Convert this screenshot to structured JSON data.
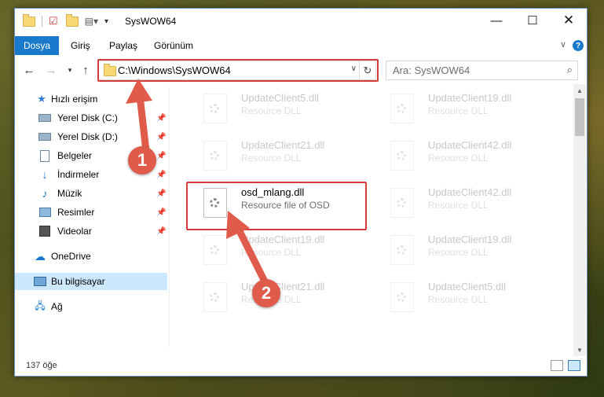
{
  "window": {
    "title": "SysWOW64"
  },
  "ribbon": {
    "tabs": [
      "Dosya",
      "Giriş",
      "Paylaş",
      "Görünüm"
    ],
    "help": "?"
  },
  "navbar": {
    "address": "C:\\Windows\\SysWOW64",
    "search_placeholder": "Ara: SysWOW64"
  },
  "sidebar": {
    "items": [
      {
        "label": "Hızlı erişim",
        "icon": "star-icon",
        "pinned": false
      },
      {
        "label": "Yerel Disk (C:)",
        "icon": "drive-icon",
        "pinned": true
      },
      {
        "label": "Yerel Disk (D:)",
        "icon": "drive-icon",
        "pinned": true
      },
      {
        "label": "Belgeler",
        "icon": "documents-icon",
        "pinned": true
      },
      {
        "label": "İndirmeler",
        "icon": "download-icon",
        "pinned": true
      },
      {
        "label": "Müzik",
        "icon": "music-icon",
        "pinned": true
      },
      {
        "label": "Resimler",
        "icon": "pictures-icon",
        "pinned": true
      },
      {
        "label": "Videolar",
        "icon": "video-icon",
        "pinned": true
      },
      {
        "label": "OneDrive",
        "icon": "cloud-icon",
        "pinned": false
      },
      {
        "label": "Bu bilgisayar",
        "icon": "computer-icon",
        "pinned": false,
        "selected": true
      },
      {
        "label": "Ağ",
        "icon": "network-icon",
        "pinned": false
      }
    ]
  },
  "files": [
    {
      "name": "UpdateClient5.dll",
      "type": "Resource DLL",
      "faded": true
    },
    {
      "name": "UpdateClient19.dll",
      "type": "Resource DLL",
      "faded": true
    },
    {
      "name": "UpdateClient21.dll",
      "type": "Resource DLL",
      "faded": true
    },
    {
      "name": "UpdateClient42.dll",
      "type": "Resource DLL",
      "faded": true
    },
    {
      "name": "osd_mlang.dll",
      "type": "Resource file of OSD",
      "faded": false
    },
    {
      "name": "UpdateClient42.dll",
      "type": "Resource DLL",
      "faded": true
    },
    {
      "name": "UpdateClient19.dll",
      "type": "Resource DLL",
      "faded": true
    },
    {
      "name": "UpdateClient19.dll",
      "type": "Resource DLL",
      "faded": true
    },
    {
      "name": "UpdateClient21.dll",
      "type": "Resource DLL",
      "faded": true
    },
    {
      "name": "UpdateClient5.dll",
      "type": "Resource DLL",
      "faded": true
    }
  ],
  "status": {
    "count": "137 öğe"
  },
  "annotations": {
    "step1": "1",
    "step2": "2"
  },
  "colors": {
    "accent": "#1979ca",
    "highlight_box": "#d43c3c",
    "badge": "#e05b4a"
  }
}
